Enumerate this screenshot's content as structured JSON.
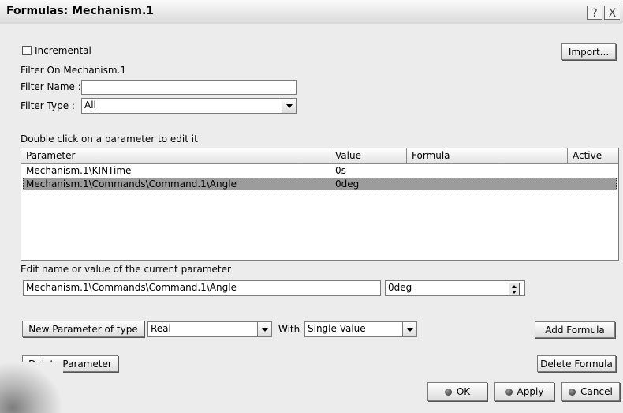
{
  "window": {
    "title": "Formulas: Mechanism.1",
    "help": "?",
    "close": "X"
  },
  "top": {
    "incremental_label": "Incremental",
    "import_label": "Import...",
    "filter_on_label": "Filter On Mechanism.1",
    "filter_name_label": "Filter Name :",
    "filter_name_value": "",
    "filter_type_label": "Filter Type :",
    "filter_type_value": "All"
  },
  "table": {
    "hint": "Double click on a parameter to edit it",
    "headers": {
      "parameter": "Parameter",
      "value": "Value",
      "formula": "Formula",
      "active": "Active"
    },
    "rows": [
      {
        "parameter": "Mechanism.1\\KINTime",
        "value": "0s",
        "formula": "",
        "active": ""
      },
      {
        "parameter": "Mechanism.1\\Commands\\Command.1\\Angle",
        "value": "0deg",
        "formula": "",
        "active": "",
        "selected": true
      }
    ]
  },
  "edit": {
    "label": "Edit name or value of the current parameter",
    "name_value": "Mechanism.1\\Commands\\Command.1\\Angle",
    "value_value": "0deg"
  },
  "new_param": {
    "button_label": "New Parameter of type",
    "type_value": "Real",
    "with_label": "With",
    "with_value": "Single Value",
    "add_formula_label": "Add Formula"
  },
  "actions": {
    "delete_parameter_label": "Delete Parameter",
    "delete_formula_label": "Delete Formula",
    "ok_label": "OK",
    "apply_label": "Apply",
    "cancel_label": "Cancel"
  }
}
